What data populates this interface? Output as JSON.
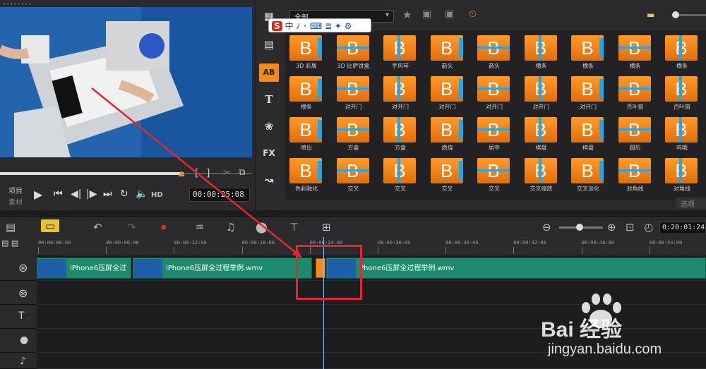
{
  "preview": {
    "grip": "••••••••",
    "mode_project": "项目",
    "mode_clip": "素材",
    "hd": "HD",
    "timecode": "00:00:25:08"
  },
  "library": {
    "dropdown": "全部",
    "options_label": "选项",
    "sidebar_items": [
      {
        "icon": "media-icon",
        "glyph": "▦"
      },
      {
        "icon": "instant-project-icon",
        "glyph": "▤"
      },
      {
        "icon": "transition-icon",
        "glyph": "AB"
      },
      {
        "icon": "title-icon",
        "glyph": "T"
      },
      {
        "icon": "graphic-icon",
        "glyph": "❀"
      },
      {
        "icon": "filter-icon",
        "glyph": "FX"
      },
      {
        "icon": "path-icon",
        "glyph": "↝"
      }
    ],
    "transitions": [
      "3D 彩屑",
      "3D 比萨饼盒",
      "手风琴",
      "箭头",
      "箭头",
      "横条",
      "横条",
      "横条",
      "横条",
      "横条",
      "对开门",
      "对开门",
      "对开门",
      "对开门",
      "对开门",
      "对开门",
      "百叶窗",
      "百叶窗",
      "喷出",
      "方盒",
      "方盒",
      "燃烧",
      "居中",
      "棋盘",
      "棋盘",
      "圆形",
      "呜哦",
      "色彩融化",
      "交叉",
      "交叉",
      "交叉",
      "交叉",
      "交叉缩放",
      "交叉淡化",
      "对角线",
      "对角线"
    ]
  },
  "ime": {
    "logo": "S",
    "text": "中 ﾉ ･ ⌨ ≣ ✦ ⚙"
  },
  "timeline": {
    "zoom_time": "0:20:01:24",
    "ruler": [
      "00:00:00:00",
      "00:00:06:00",
      "00:00:12:00",
      "00:00:18:00",
      "00:00:24:00",
      "00:00:30:00",
      "00:00:36:00",
      "00:00:42:00",
      "00:00:48:00",
      "00:00:54:00"
    ],
    "clips": [
      {
        "label": "iPhone6压屏全过"
      },
      {
        "label": "iPhone6压屏全过程举例.wmv"
      },
      {
        "label": "Phone6压屏全过程举例.wmv"
      }
    ]
  },
  "watermark": {
    "brand": "Bai 经验",
    "url": "jingyan.baidu.com"
  },
  "colors": {
    "accent": "#1d8a6e",
    "highlight": "#e4272b",
    "thumb": "#f5891a"
  }
}
